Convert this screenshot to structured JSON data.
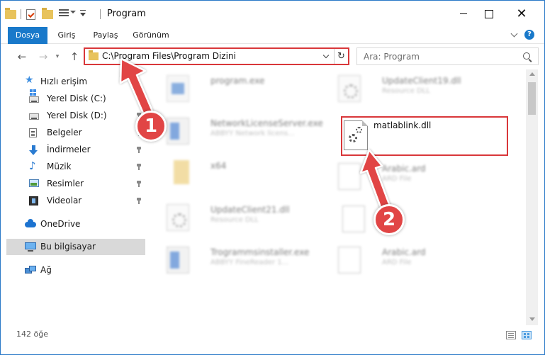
{
  "window": {
    "title": "Program",
    "border_color": "#2b79c8"
  },
  "ribbon": {
    "file_tab": "Dosya",
    "home_tab": "Giriş",
    "share_tab": "Paylaş",
    "view_tab": "Görünüm",
    "accent_color": "#1979ca"
  },
  "navigation": {
    "address_path": "C:\\Program Files\\Program Dizini",
    "search_placeholder": "Ara: Program"
  },
  "sidebar": {
    "quick_access": "Hızlı erişim",
    "items": [
      {
        "label": "Yerel Disk (C:)",
        "icon": "drive-c-icon"
      },
      {
        "label": "Yerel Disk (D:)",
        "icon": "drive-d-icon"
      },
      {
        "label": "Belgeler",
        "icon": "documents-icon"
      },
      {
        "label": "İndirmeler",
        "icon": "downloads-icon"
      },
      {
        "label": "Müzik",
        "icon": "music-icon"
      },
      {
        "label": "Resimler",
        "icon": "pictures-icon"
      },
      {
        "label": "Videolar",
        "icon": "videos-icon"
      }
    ],
    "onedrive": "OneDrive",
    "this_pc": "Bu bilgisayar",
    "network": "Ağ"
  },
  "files": [
    {
      "name": "program.exe",
      "desc": ""
    },
    {
      "name": "UpdateClient19.dll",
      "desc": "Resource DLL"
    },
    {
      "name": "NetworkLicenseServer.exe",
      "desc": "ABBYY Network licens..."
    },
    {
      "name": "x64",
      "desc": ""
    },
    {
      "name": "Arabic.ard",
      "desc": "ARD File"
    },
    {
      "name": "UpdateClient21.dll",
      "desc": "Resource DLL"
    },
    {
      "name": "Trogrammsinstaller.exe",
      "desc": "ABBYY FineReader 1..."
    },
    {
      "name": "Arabic.ard",
      "desc": "ARD File"
    }
  ],
  "highlighted_file": {
    "name": "matlablink.dll"
  },
  "status": {
    "item_count": "142 öğe"
  },
  "callouts": [
    {
      "label": "1"
    },
    {
      "label": "2"
    }
  ],
  "callout_color": "#e14545"
}
